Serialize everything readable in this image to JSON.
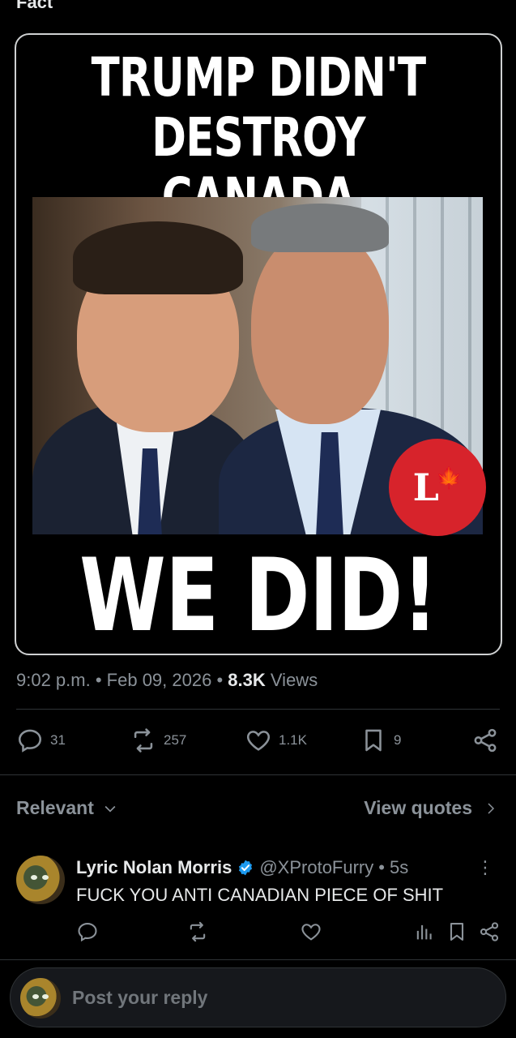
{
  "header": {
    "partial_title": "Fact"
  },
  "media": {
    "headline_top_line1": "TRUMP DIDN'T",
    "headline_top_line2": "DESTROY CANADA",
    "headline_bottom": "WE DID!",
    "badge_letter": "L",
    "badge_leaf": "🍁"
  },
  "post_meta": {
    "time": "9:02 p.m.",
    "sep1": "•",
    "date": "Feb 09, 2026",
    "sep2": "•",
    "views_count": "8.3K",
    "views_label": "Views"
  },
  "actions": {
    "replies": "31",
    "reposts": "257",
    "likes": "1.1K",
    "bookmarks": "9"
  },
  "filters": {
    "sort_label": "Relevant",
    "quotes_label": "View quotes"
  },
  "reply": {
    "name": "Lyric Nolan Morris",
    "handle": "@XProtoFurry",
    "sep": "•",
    "age": "5s",
    "text": "FUCK YOU ANTI CANADIAN PIECE OF SHIT",
    "more": "⋮"
  },
  "composer": {
    "placeholder": "Post your reply"
  },
  "colors": {
    "background": "#000000",
    "muted": "#8b9299",
    "text": "#e7e9ea",
    "verified": "#1d9bf0",
    "badge": "#d7232b"
  }
}
